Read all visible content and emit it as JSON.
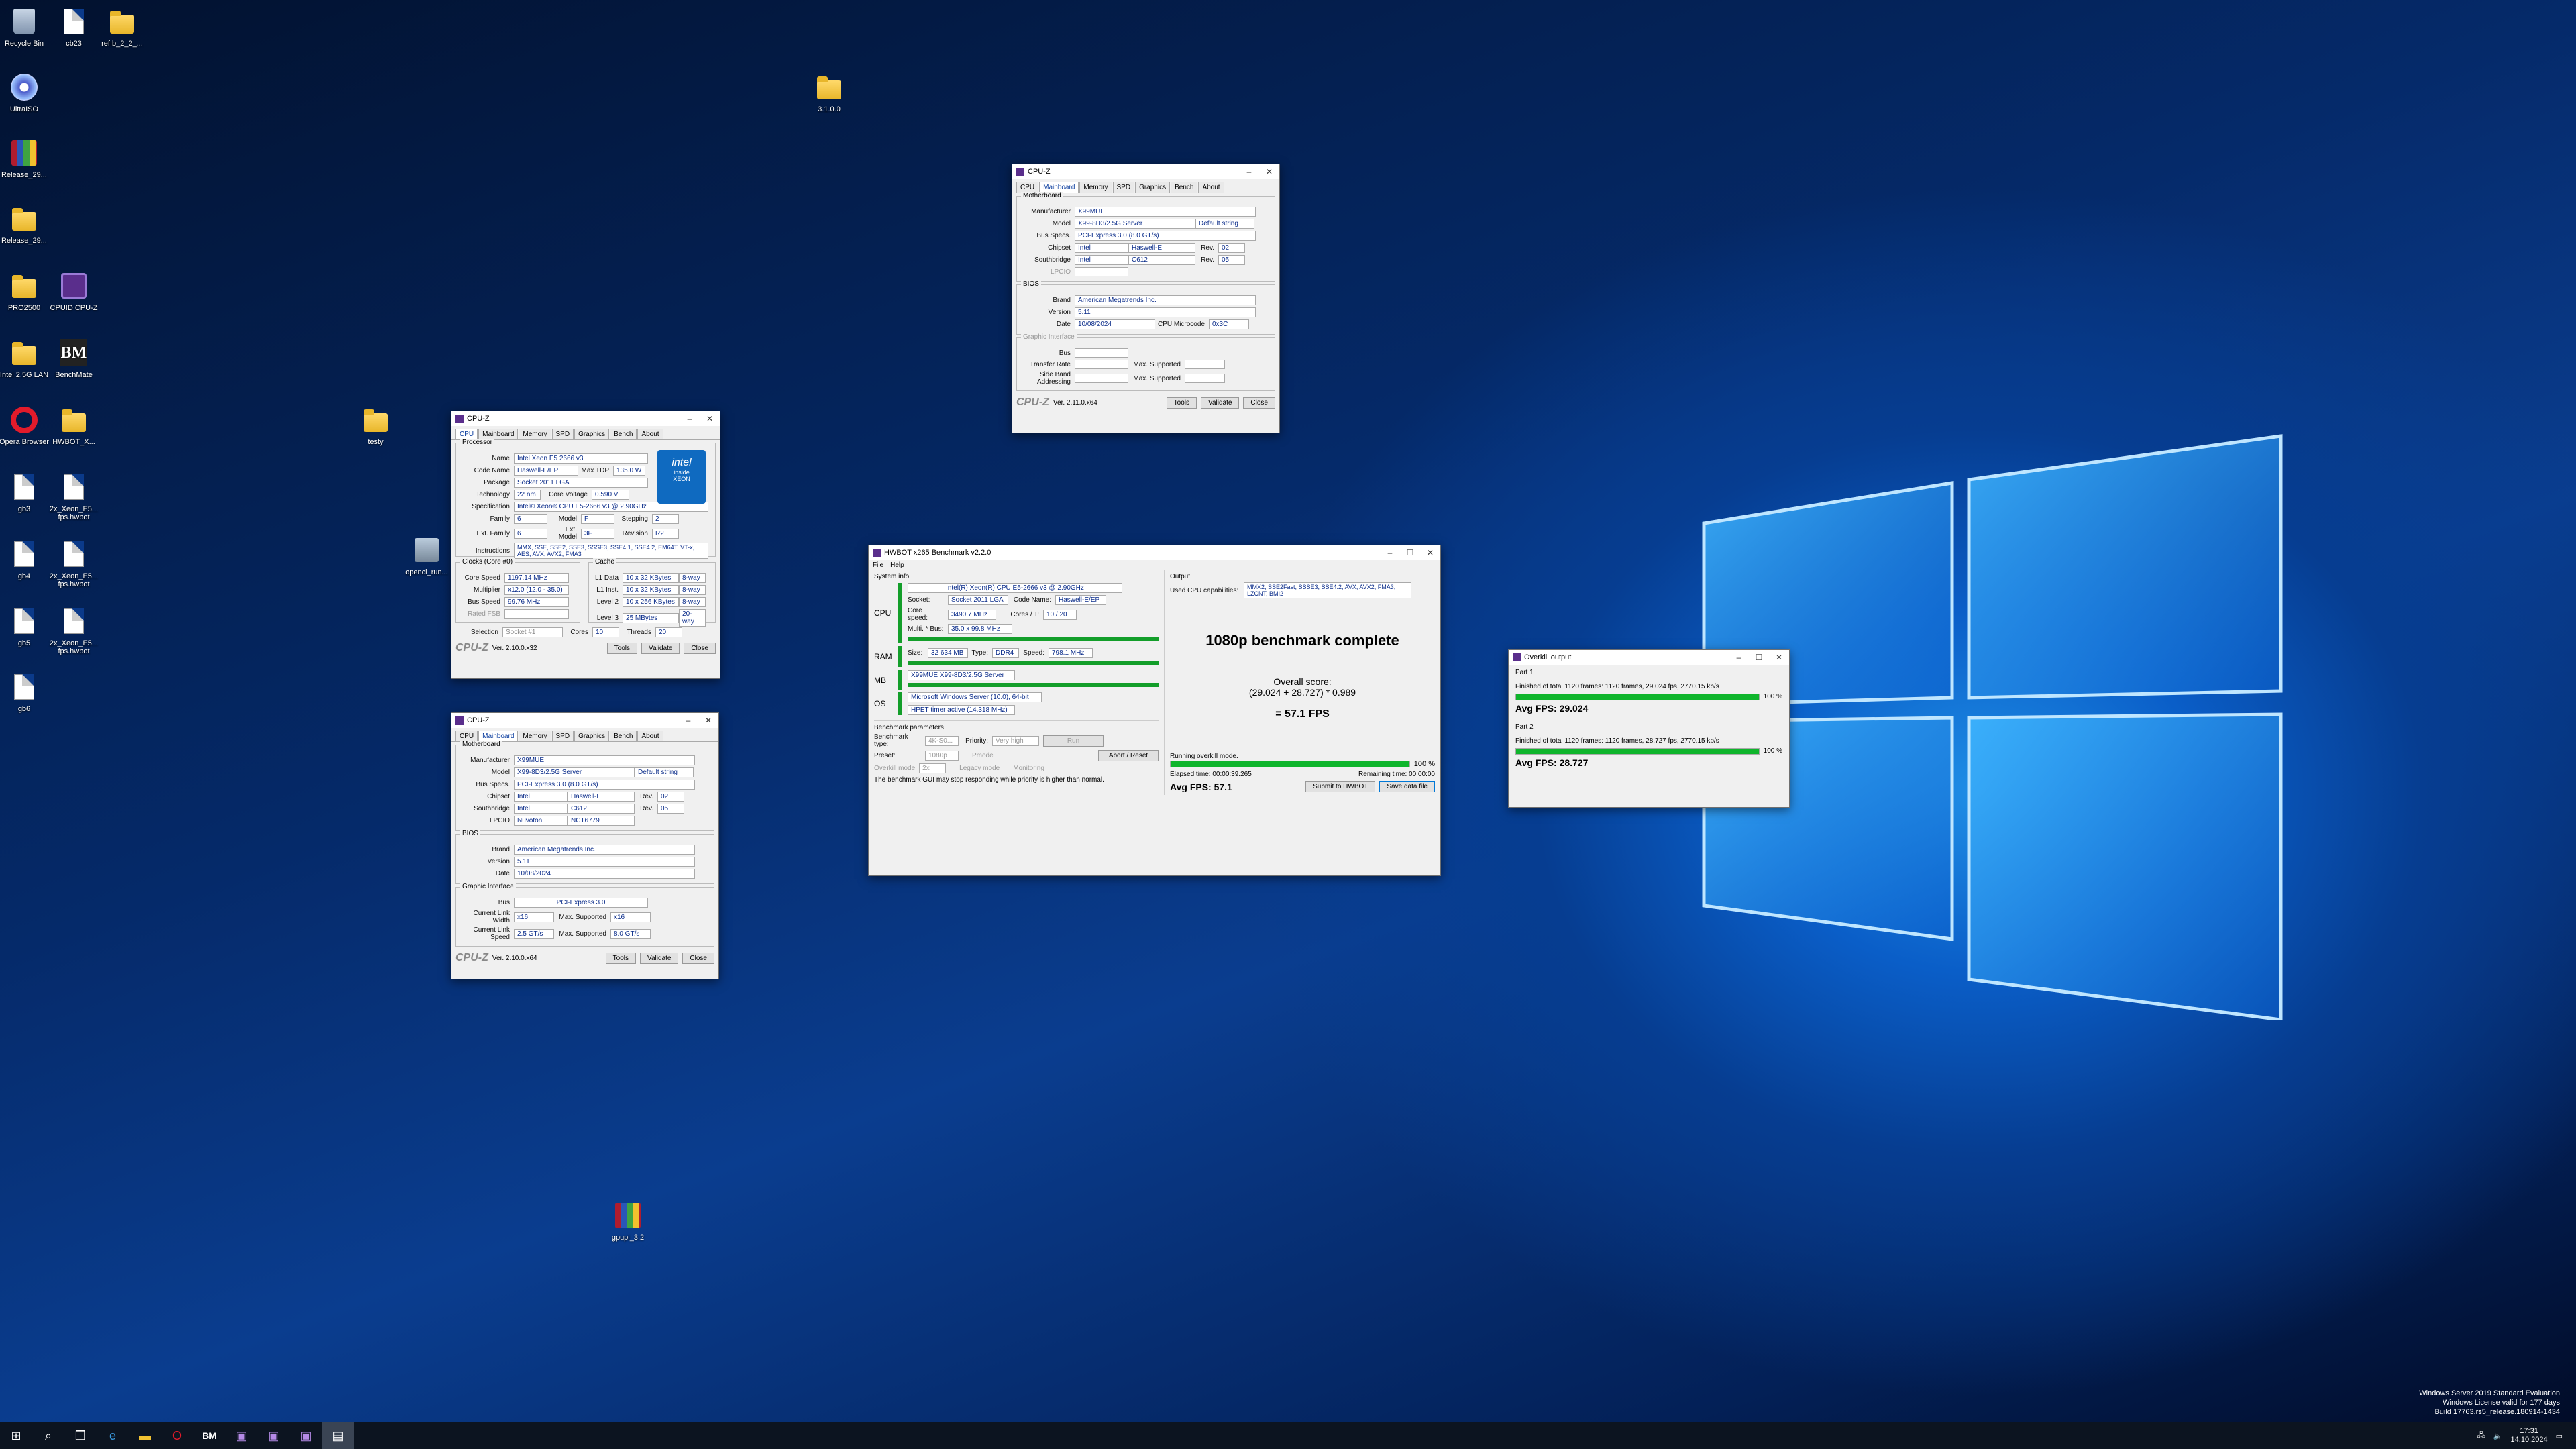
{
  "desktop": {
    "icons": [
      {
        "label": "Recycle Bin",
        "kind": "bin"
      },
      {
        "label": "cb23",
        "kind": "file"
      },
      {
        "label": "refıb_2_2_...",
        "kind": "folder"
      },
      {
        "label": "UltraISO",
        "kind": "disc"
      },
      {
        "label": "Release_29...",
        "kind": "rar"
      },
      {
        "label": "Release_29...",
        "kind": "folder"
      },
      {
        "label": "PRO2500",
        "kind": "folder"
      },
      {
        "label": "CPUID CPU-Z",
        "kind": "cpuz"
      },
      {
        "label": "Intel 2.5G LAN",
        "kind": "folder"
      },
      {
        "label": "BenchMate",
        "kind": "bm"
      },
      {
        "label": "Opera Browser",
        "kind": "opera"
      },
      {
        "label": "HWBOT_X...",
        "kind": "folder"
      },
      {
        "label": "gb3",
        "kind": "file"
      },
      {
        "label": "2x_Xeon_E5... fps.hwbot",
        "kind": "file"
      },
      {
        "label": "gb4",
        "kind": "file"
      },
      {
        "label": "2x_Xeon_E5... fps.hwbot",
        "kind": "file"
      },
      {
        "label": "gb5",
        "kind": "file"
      },
      {
        "label": "2x_Xeon_E5... fps.hwbot",
        "kind": "file"
      },
      {
        "label": "gb6",
        "kind": "file"
      },
      {
        "label": "3.1.0.0",
        "kind": "folder"
      },
      {
        "label": "testy",
        "kind": "folder"
      },
      {
        "label": "opencl_run...",
        "kind": "exe"
      },
      {
        "label": "gpupi_3.2",
        "kind": "rar"
      }
    ]
  },
  "cpuz_cpu": {
    "title": "CPU-Z",
    "tabs": [
      "CPU",
      "Mainboard",
      "Memory",
      "SPD",
      "Graphics",
      "Bench",
      "About"
    ],
    "proc_label": "Processor",
    "name": "Intel Xeon E5 2666 v3",
    "codename": "Haswell-E/EP",
    "maxtdp": "135.0 W",
    "package": "Socket 2011 LGA",
    "technology": "22 nm",
    "corevoltage": "0.590 V",
    "spec": "Intel® Xeon® CPU E5-2666 v3 @ 2.90GHz",
    "family": "6",
    "model": "F",
    "stepping": "2",
    "extfamily": "6",
    "extmodel": "3F",
    "revision": "R2",
    "instructions": "MMX, SSE, SSE2, SSE3, SSSE3, SSE4.1, SSE4.2, EM64T, VT-x, AES, AVX, AVX2, FMA3",
    "clocks_label": "Clocks (Core #0)",
    "corespeed": "1197.14 MHz",
    "multiplier": "x12.0 (12.0 - 35.0)",
    "busspeed": "99.76 MHz",
    "ratedfsb": "",
    "cache_label": "Cache",
    "l1d": "10 x 32 KBytes",
    "l1d_w": "8-way",
    "l1i": "10 x 32 KBytes",
    "l1i_w": "8-way",
    "l2": "10 x 256 KBytes",
    "l2_w": "8-way",
    "l3": "25 MBytes",
    "l3_w": "20-way",
    "selection": "Socket #1",
    "cores": "10",
    "threads": "20",
    "version": "Ver. 2.10.0.x32",
    "labels": {
      "name": "Name",
      "codename": "Code Name",
      "maxtdp": "Max TDP",
      "package": "Package",
      "technology": "Technology",
      "corevoltage": "Core Voltage",
      "spec": "Specification",
      "family": "Family",
      "model": "Model",
      "stepping": "Stepping",
      "extfamily": "Ext. Family",
      "extmodel": "Ext. Model",
      "revision": "Revision",
      "instructions": "Instructions",
      "corespeed": "Core Speed",
      "multiplier": "Multiplier",
      "busspeed": "Bus Speed",
      "ratedfsb": "Rated FSB",
      "l1d": "L1 Data",
      "l1i": "L1 Inst.",
      "l2": "Level 2",
      "l3": "Level 3",
      "selection": "Selection",
      "cores": "Cores",
      "threads": "Threads"
    }
  },
  "cpuz_mb1": {
    "title": "CPU-Z",
    "mb_label": "Motherboard",
    "manufacturer": "X99MUE",
    "model": "X99-8D3/2.5G Server",
    "model_extra": "Default string",
    "busspecs": "PCI-Express 3.0 (8.0 GT/s)",
    "chipset": "Intel",
    "chipset2": "Haswell-E",
    "chipset_rev": "02",
    "southbridge": "Intel",
    "southbridge2": "C612",
    "southbridge_rev": "05",
    "lpcio": "Nuvoton",
    "lpcio2": "NCT6779",
    "bios_label": "BIOS",
    "brand": "American Megatrends Inc.",
    "bios_version": "5.11",
    "date": "10/08/2024",
    "gi_label": "Graphic Interface",
    "bus": "PCI-Express 3.0",
    "linkwidth": "x16",
    "linkwidth_max": "x16",
    "linkspeed": "2.5 GT/s",
    "linkspeed_max": "8.0 GT/s",
    "version": "Ver. 2.10.0.x64",
    "labels": {
      "manufacturer": "Manufacturer",
      "model": "Model",
      "busspecs": "Bus Specs.",
      "chipset": "Chipset",
      "southbridge": "Southbridge",
      "lpcio": "LPCIO",
      "rev": "Rev.",
      "brand": "Brand",
      "version": "Version",
      "date": "Date",
      "bus": "Bus",
      "linkwidth": "Current Link Width",
      "linkspeed": "Current Link Speed",
      "maxsup": "Max. Supported"
    }
  },
  "cpuz_mb2": {
    "title": "CPU-Z",
    "manufacturer": "X99MUE",
    "model": "X99-8D3/2.5G Server",
    "model_extra": "Default string",
    "busspecs": "PCI-Express 3.0 (8.0 GT/s)",
    "chipset": "Intel",
    "chipset2": "Haswell-E",
    "chipset_rev": "02",
    "southbridge": "Intel",
    "southbridge2": "C612",
    "southbridge_rev": "05",
    "brand": "American Megatrends Inc.",
    "bios_version": "5.11",
    "date": "10/08/2024",
    "microcode_label": "CPU Microcode",
    "microcode": "0x3C",
    "gi_bus": "Bus",
    "gi_transfer": "Transfer Rate",
    "gi_sideband": "Side Band Addressing",
    "version": "Ver. 2.11.0.x64"
  },
  "buttons": {
    "tools": "Tools",
    "validate": "Validate",
    "close": "Close"
  },
  "hwbot": {
    "title": "HWBOT x265 Benchmark v2.2.0",
    "menu": [
      "File",
      "Help"
    ],
    "sysinfo_label": "System info",
    "cpu_tag": "CPU",
    "ram_tag": "RAM",
    "mb_tag": "MB",
    "os_tag": "OS",
    "cpu_name": "Intel(R) Xeon(R) CPU E5-2666 v3 @ 2.90GHz",
    "socket_l": "Socket:",
    "socket": "Socket 2011 LGA",
    "codename_l": "Code Name:",
    "codename": "Haswell-E/EP",
    "corespeed_l": "Core speed:",
    "corespeed": "3490.7 MHz",
    "corest_l": "Cores / T:",
    "corest": "10 / 20",
    "multbus_l": "Multi. * Bus:",
    "multbus": "35.0 x 99.8 MHz",
    "ram_size_l": "Size:",
    "ram_size": "32 634 MB",
    "ram_type_l": "Type:",
    "ram_type": "DDR4",
    "ram_speed_l": "Speed:",
    "ram_speed": "798.1 MHz",
    "mb": "X99MUE X99-8D3/2.5G Server",
    "os": "Microsoft Windows Server (10.0), 64-bit",
    "hpet": "HPET timer active (14.318 MHz)",
    "params_label": "Benchmark parameters",
    "benchtype_l": "Benchmark type:",
    "benchtype": "4K-S0...",
    "priority_l": "Priority:",
    "priority": "Very high",
    "run": "Run",
    "preset_l": "Preset:",
    "preset": "1080p",
    "pmode": "Pmode",
    "abort": "Abort / Reset",
    "overkill": "Overkill mode",
    "overkill_val": "2x",
    "legacy": "Legacy mode",
    "monitoring": "Monitoring",
    "warn": "The benchmark GUI may stop responding while priority is higher than normal.",
    "output_label": "Output",
    "caps_l": "Used CPU capabilities:",
    "caps": "MMX2, SSE2Fast, SSSE3, SSE4.2, AVX, AVX2, FMA3, LZCNT, BMI2",
    "headline": "1080p benchmark complete",
    "overall_l": "Overall score:",
    "overall_expr": "(29.024 + 28.727) * 0.989",
    "overall": "= 57.1 FPS",
    "running": "Running overkill mode.",
    "progress_pct": "100 %",
    "progress_val": 1.0,
    "elapsed": "Elapsed time: 00:00:39.265",
    "remaining": "Remaining time: 00:00:00",
    "avg": "Avg FPS: 57.1",
    "submit": "Submit to HWBOT",
    "save": "Save data file"
  },
  "overkill": {
    "title": "Overkill output",
    "parts": [
      {
        "label": "Part 1",
        "line": "Finished of total 1120 frames: 1120 frames, 29.024 fps,   2770.15 kb/s",
        "pct": "100 %",
        "avg": "Avg FPS: 29.024"
      },
      {
        "label": "Part 2",
        "line": "Finished of total 1120 frames: 1120 frames, 28.727 fps,   2770.15 kb/s",
        "pct": "100 %",
        "avg": "Avg FPS: 28.727"
      }
    ]
  },
  "watermark": {
    "line1": "Windows Server 2019 Standard Evaluation",
    "line2": "Windows License valid for 177 days",
    "line3": "Build 17763.rs5_release.180914-1434"
  },
  "tray": {
    "time": "17:31",
    "date": "14.10.2024"
  }
}
